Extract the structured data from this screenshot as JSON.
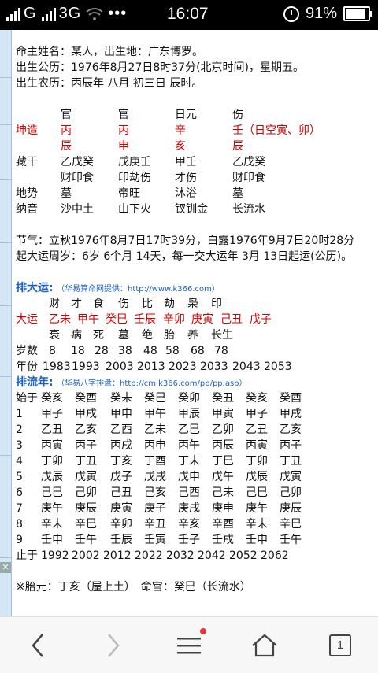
{
  "status": {
    "carrier": "G",
    "network": "3G",
    "more": "•••",
    "time": "16:07",
    "battery": "91%",
    "battery_level": 0.91
  },
  "header": {
    "line1": "命主姓名：某人，出生地：广东博罗。",
    "line2": "出生公历：1976年8月27日8时37分(北京时间)，星期五。",
    "line3": "出生农历：丙辰年 八月 初三日 辰时。"
  },
  "bazi": {
    "top": [
      "官",
      "官",
      "日元",
      "伤"
    ],
    "label": "坤造",
    "stems": [
      "丙",
      "丙",
      "辛",
      "壬（日空寅、卯）"
    ],
    "branches": [
      "辰",
      "申",
      "亥",
      "辰"
    ],
    "canggan_label": "藏干",
    "canggan1": [
      "乙戊癸",
      "戊庚壬",
      "甲壬",
      "乙戊癸"
    ],
    "canggan2": [
      "财印食",
      "印劫伤",
      "才伤",
      "财印食"
    ],
    "dishi_label": "地势",
    "dishi": [
      "墓",
      "帝旺",
      "沐浴",
      "墓"
    ],
    "nayin_label": "纳音",
    "nayin": [
      "沙中土",
      "山下火",
      "钗钏金",
      "长流水"
    ]
  },
  "jieqi": "节气：立秋1976年8月7日17时39分，白露1976年9月7日20时28分",
  "qiyun": "起大运周岁：6岁 6个月 14天，每一交大运年 3月 13日起运(公历)。",
  "dayun": {
    "title": "排大运:",
    "source": "（华易算命网提供：http://www.k366.com）",
    "gods": [
      "财",
      "才",
      "食",
      "伤",
      "比",
      "劫",
      "枭",
      "印"
    ],
    "label": "大运",
    "pillars": [
      "乙未",
      "甲午",
      "癸巳",
      "壬辰",
      "辛卯",
      "庚寅",
      "己丑",
      "戊子"
    ],
    "phases": [
      "衰",
      "病",
      "死",
      "墓",
      "绝",
      "胎",
      "养",
      "长生"
    ],
    "age_label": "岁数",
    "ages": [
      "8",
      "18",
      "28",
      "38",
      "48",
      "58",
      "68",
      "78"
    ],
    "year_label": "年份",
    "years": [
      "1983",
      "1993",
      "2003",
      "2013",
      "2023",
      "2033",
      "2043",
      "2053"
    ]
  },
  "liunian": {
    "title": "排流年:",
    "source": "（华易八字排盘：http://cm.k366.com/pp/pp.asp）",
    "start_label": "始于",
    "start": [
      "癸亥",
      "癸酉",
      "癸未",
      "癸巳",
      "癸卯",
      "癸丑",
      "癸亥",
      "癸酉"
    ],
    "rows": [
      {
        "n": "1",
        "cells": [
          "甲子",
          "甲戌",
          "甲申",
          "甲午",
          "甲辰",
          "甲寅",
          "甲子",
          "甲戌"
        ]
      },
      {
        "n": "2",
        "cells": [
          "乙丑",
          "乙亥",
          "乙酉",
          "乙未",
          "乙巳",
          "乙卯",
          "乙丑",
          "乙亥"
        ]
      },
      {
        "n": "3",
        "cells": [
          "丙寅",
          "丙子",
          "丙戌",
          "丙申",
          "丙午",
          "丙辰",
          "丙寅",
          "丙子"
        ]
      },
      {
        "n": "4",
        "cells": [
          "丁卯",
          "丁丑",
          "丁亥",
          "丁酉",
          "丁未",
          "丁巳",
          "丁卯",
          "丁丑"
        ]
      },
      {
        "n": "5",
        "cells": [
          "戊辰",
          "戊寅",
          "戊子",
          "戊戌",
          "戊申",
          "戊午",
          "戊辰",
          "戊寅"
        ]
      },
      {
        "n": "6",
        "cells": [
          "己巳",
          "己卯",
          "己丑",
          "己亥",
          "己酉",
          "己未",
          "己巳",
          "己卯"
        ]
      },
      {
        "n": "7",
        "cells": [
          "庚午",
          "庚辰",
          "庚寅",
          "庚子",
          "庚戌",
          "庚申",
          "庚午",
          "庚辰"
        ]
      },
      {
        "n": "8",
        "cells": [
          "辛未",
          "辛巳",
          "辛卯",
          "辛丑",
          "辛亥",
          "辛酉",
          "辛未",
          "辛巳"
        ]
      },
      {
        "n": "9",
        "cells": [
          "壬申",
          "壬午",
          "壬辰",
          "壬寅",
          "壬子",
          "壬戌",
          "壬申",
          "壬午"
        ]
      }
    ],
    "end_label": "止于",
    "end": [
      "1992",
      "2002",
      "2012",
      "2022",
      "2032",
      "2042",
      "2052",
      "2062"
    ]
  },
  "taiyuan": "※胎元：丁亥（屋上土）　命宫：癸巳（长流水）",
  "nav": {
    "tab_count": "1"
  },
  "icons": {
    "back": "chevron-left-icon",
    "forward": "chevron-right-icon",
    "menu": "menu-icon",
    "home": "home-icon",
    "tabs": "tabs-icon"
  },
  "colors": {
    "red": "#d40000",
    "blue": "#1a5fc8"
  }
}
